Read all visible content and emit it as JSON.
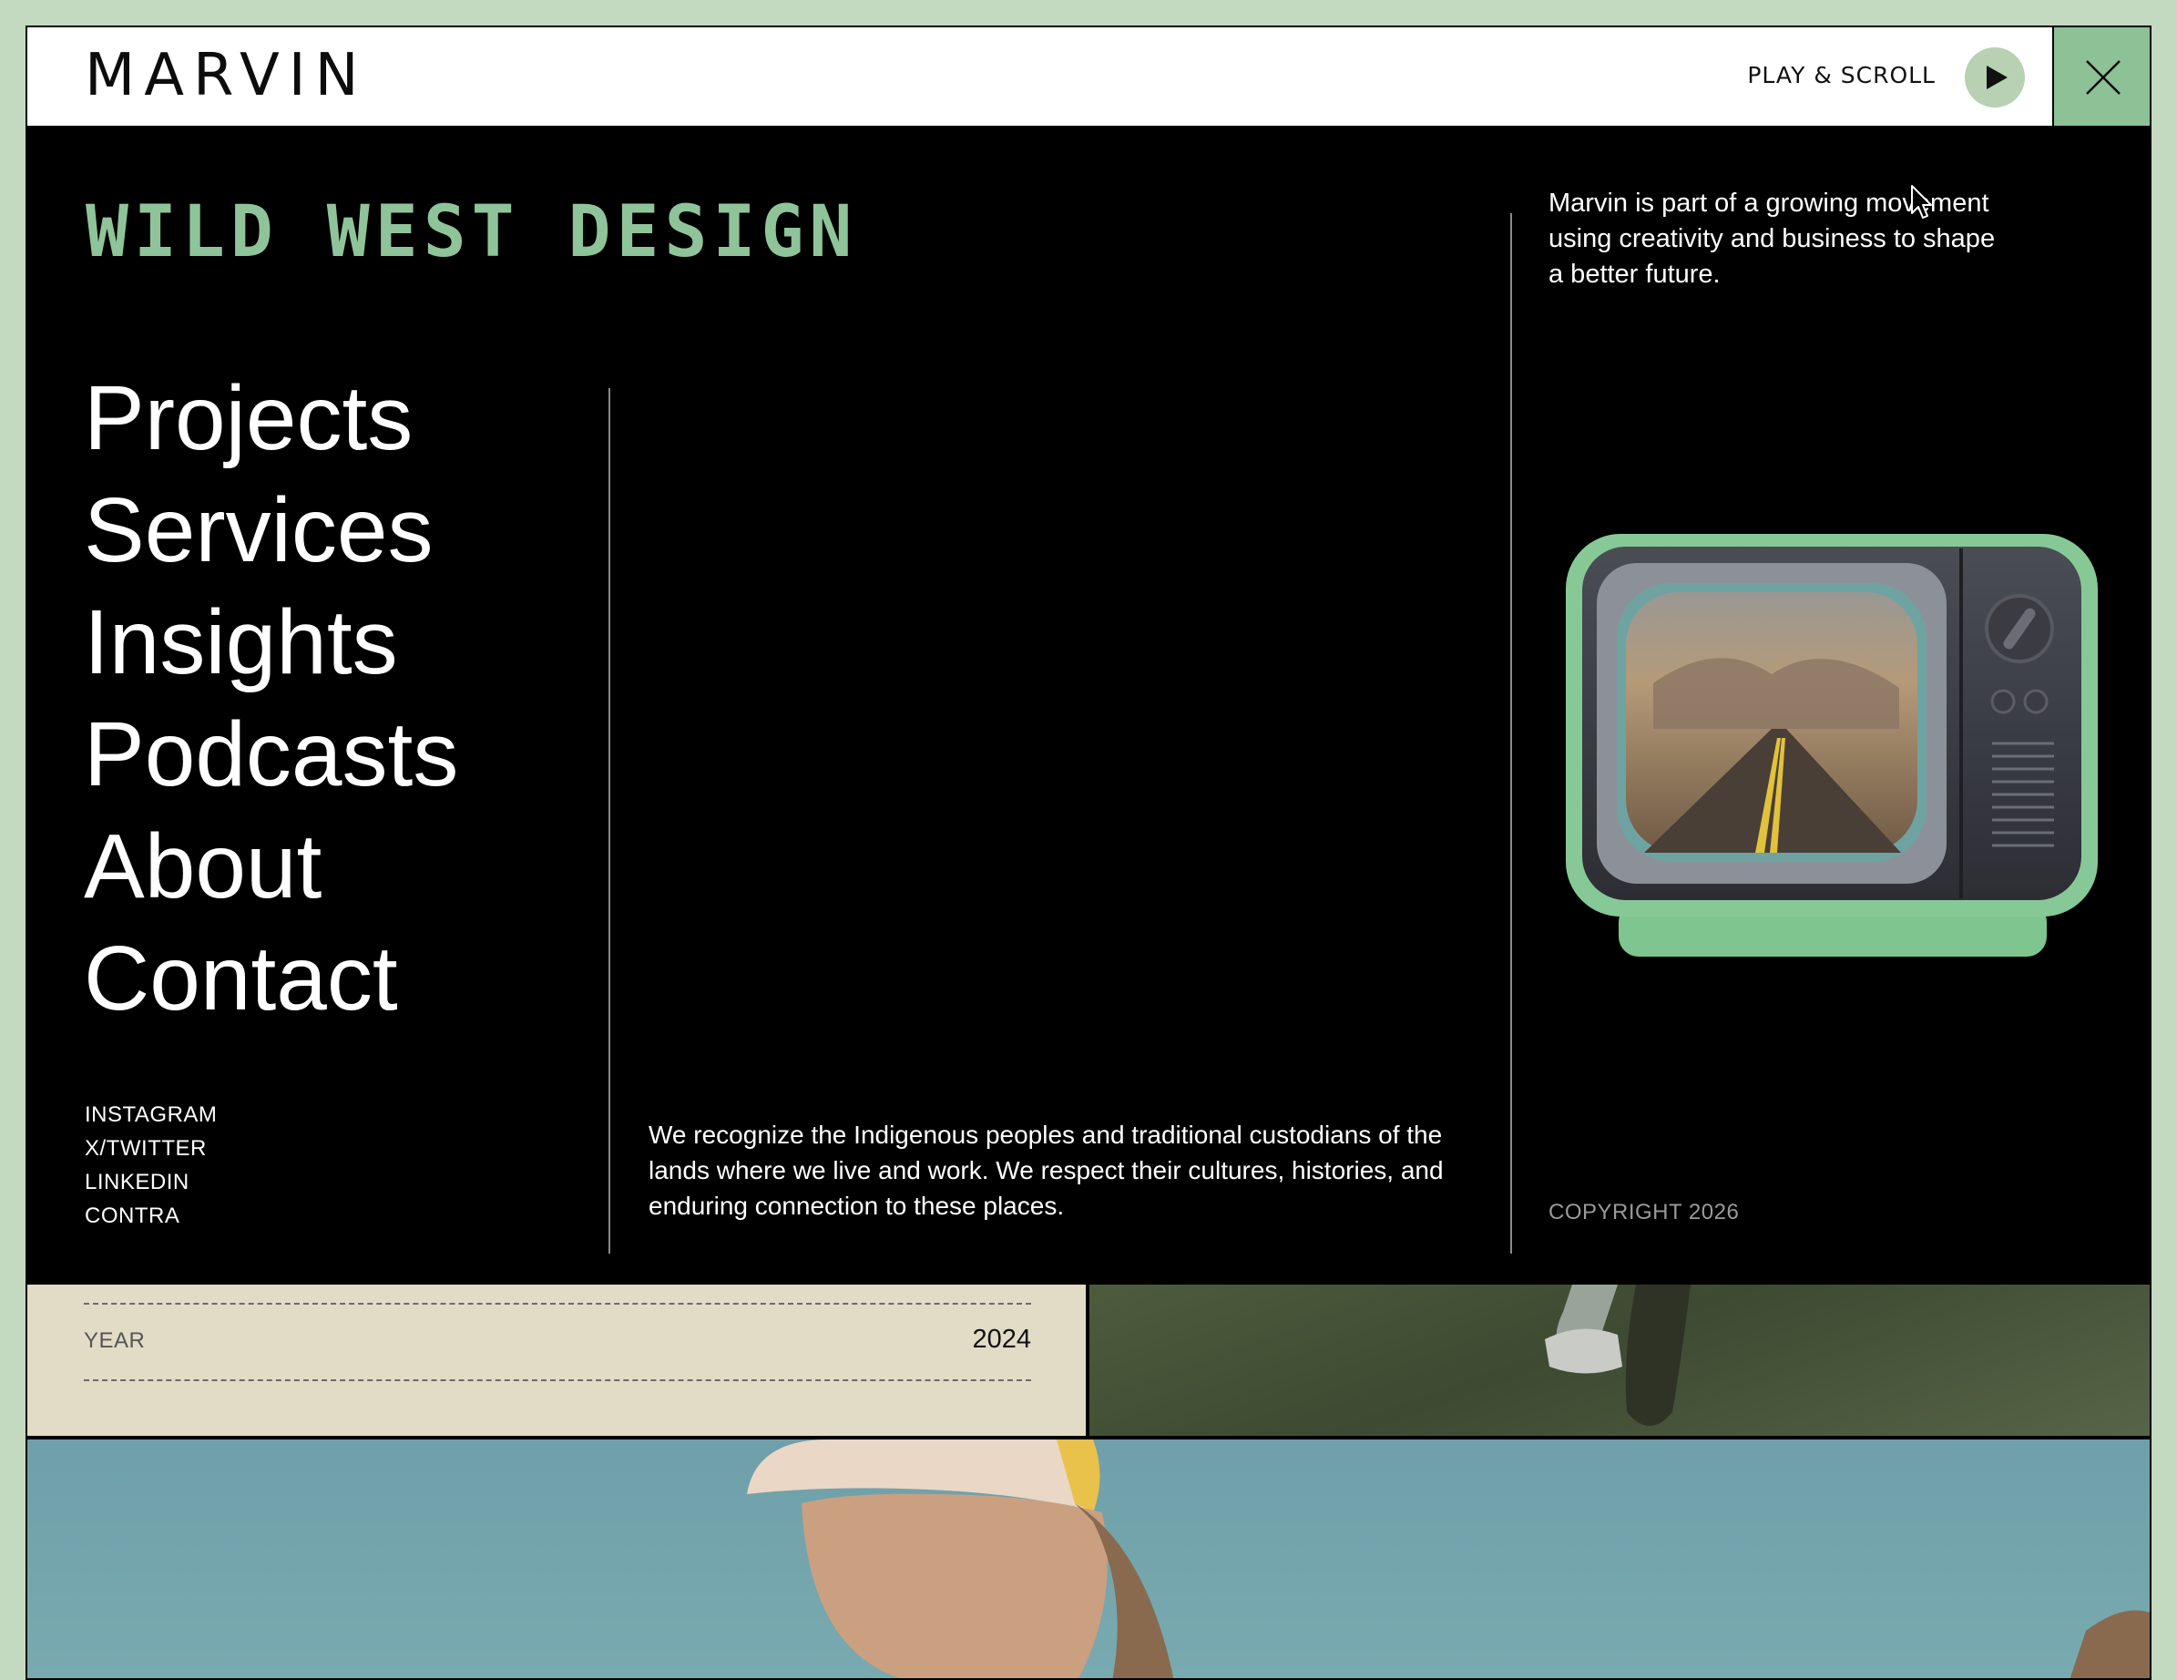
{
  "header": {
    "logo": "MARVIN",
    "play_label": "PLAY & SCROLL"
  },
  "menu": {
    "brand_title": "WILD WEST DESIGN",
    "nav_items": [
      "Projects",
      "Services",
      "Insights",
      "Podcasts",
      "About",
      "Contact"
    ],
    "socials": [
      "INSTAGRAM",
      "X/TWITTER",
      "LINKEDIN",
      "CONTRA"
    ],
    "acknowledgement": "We recognize the Indigenous peoples and traditional custodians of the lands where we live and work. We respect their cultures, histories, and enduring connection to these places.",
    "blurb": "Marvin is part of a growing movement using creativity and business to shape a better future.",
    "copyright": "COPYRIGHT 2026"
  },
  "project_info": {
    "year_label": "YEAR",
    "year_value": "2024"
  },
  "colors": {
    "page_bg": "#c4dac0",
    "accent_green": "#8cc295",
    "title_green": "#8fc49a",
    "menu_bg": "#000000",
    "info_bg": "#e2dcc6"
  },
  "icons": {
    "play": "play-icon",
    "close": "close-icon",
    "cursor": "pointer-cursor-icon",
    "tv": "retro-tv-illustration"
  }
}
